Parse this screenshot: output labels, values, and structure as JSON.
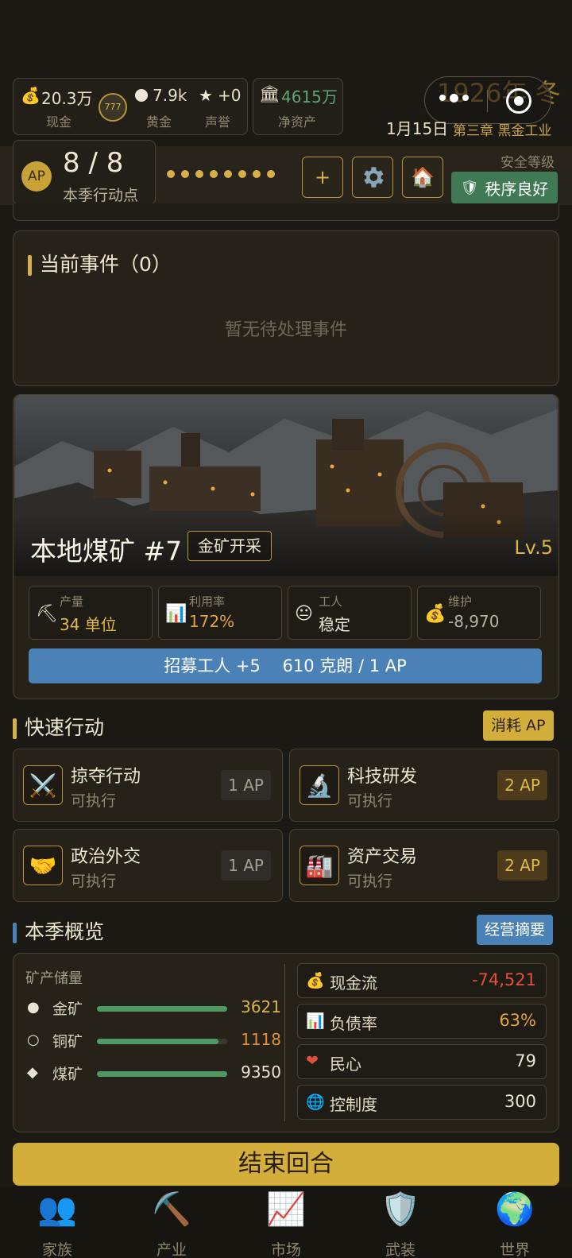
{
  "status": {
    "cash_value": "20.3万",
    "cash_label": "现金",
    "gold_value": "7.9k",
    "gold_label": "黄金",
    "fame_value": "+0",
    "fame_label": "声誉",
    "networth_value": "4615万",
    "networth_label": "净资产",
    "year_season": "1926年 冬",
    "date": "1月15日",
    "chapter": "第三章 黑金工业"
  },
  "ap": {
    "badge": "AP",
    "value": "8 / 8",
    "label": "本季行动点",
    "dots": 8,
    "add_label": "+",
    "safety_title": "安全等级",
    "safety_value": "秩序良好"
  },
  "events": {
    "title": "当前事件（0）",
    "empty": "暂无待处理事件"
  },
  "mine": {
    "name": "本地煤矿 #7",
    "tag": "金矿开采",
    "level": "Lv.5",
    "stats": [
      {
        "icon": "pickaxe-icon",
        "label": "产量",
        "value": "34 单位",
        "color": "#e0b94a"
      },
      {
        "icon": "chart-icon",
        "label": "利用率",
        "value": "172%",
        "color": "#e0a43a"
      },
      {
        "icon": "face-icon",
        "label": "工人",
        "value": "稳定",
        "color": "#e9e3d5"
      },
      {
        "icon": "moneybag-icon",
        "label": "维护",
        "value": "-8,970",
        "color": "#b9b1a0"
      }
    ],
    "recruit": "招募工人 +5　 610 克朗 / 1 AP",
    "recruit_color": "#4a82b8"
  },
  "quick": {
    "title": "快速行动",
    "badge": "消耗 AP",
    "actions": [
      {
        "name": "掠夺行动",
        "state": "可执行",
        "cost": "1 AP"
      },
      {
        "name": "科技研发",
        "state": "可执行",
        "cost": "2 AP"
      },
      {
        "name": "政治外交",
        "state": "可执行",
        "cost": "1 AP"
      },
      {
        "name": "资产交易",
        "state": "可执行",
        "cost": "2 AP"
      }
    ]
  },
  "overview": {
    "title": "本季概览",
    "badge": "经营摘要",
    "reserves_title": "矿产储量",
    "ores": [
      {
        "name": "金矿",
        "value": "3621",
        "fill": 1.0,
        "color": "#d8b44a"
      },
      {
        "name": "铜矿",
        "value": "1118",
        "fill": 0.93,
        "color": "#e0903a"
      },
      {
        "name": "煤矿",
        "value": "9350",
        "fill": 1.0,
        "color": "#e9e3d5"
      }
    ],
    "metrics": [
      {
        "label": "现金流",
        "value": "-74,521",
        "color": "#e0503a"
      },
      {
        "label": "负债率",
        "value": "63%",
        "color": "#e0a43a"
      },
      {
        "label": "民心",
        "value": "79",
        "color": "#e9e3d5"
      },
      {
        "label": "控制度",
        "value": "300",
        "color": "#e9e3d5"
      }
    ]
  },
  "end_turn": "结束回合",
  "tabs": [
    "家族",
    "产业",
    "市场",
    "武装",
    "世界"
  ],
  "colors": {
    "accent": "#d4ae3a",
    "safety": "#3f7a55",
    "blue": "#4a82b8"
  }
}
